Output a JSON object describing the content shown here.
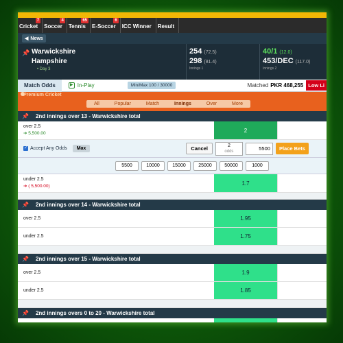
{
  "sports": [
    {
      "label": "Cricket",
      "badge": "7"
    },
    {
      "label": "Soccer",
      "badge": "4"
    },
    {
      "label": "Tennis",
      "badge": "65"
    },
    {
      "label": "E-Soccer",
      "badge": "6"
    },
    {
      "label": "ICC Winner",
      "badge": ""
    },
    {
      "label": "Result",
      "badge": ""
    }
  ],
  "news_label": "News",
  "scoreboard": {
    "team1": "Warwickshire",
    "team2": "Hampshire",
    "day": "Day 3",
    "score1": "254",
    "overs1": "(72.5)",
    "score2": "298",
    "overs2": "(81.4)",
    "innings1": "Innings 1",
    "right_score1": "40/1",
    "right_overs1": "(12.0)",
    "right_score2": "453/DEC",
    "right_overs2": "(117.0)",
    "innings2": "Innings 2"
  },
  "oddsbar": {
    "match_odds": "Match Odds",
    "inplay": "In-Play",
    "minmax": "Min/Max 100 / 30000",
    "matched_label": "Matched",
    "matched_value": "PKR 468,255",
    "low_liquidity": "Low Li"
  },
  "filter": {
    "ghost_text": "Premium Cricket",
    "tabs": [
      "All",
      "Popular",
      "Match",
      "Innings",
      "Over",
      "More"
    ]
  },
  "markets": [
    {
      "title": "2nd innings over 13 - Warwickshire total",
      "over": {
        "label": "over 2.5",
        "pl": "5,500.00",
        "odds": "2"
      },
      "betslip": {
        "accept": "Accept Any Odds",
        "max": "Max",
        "cancel": "Cancel",
        "odds_value": "2",
        "odds_label": "odds",
        "stake": "5500",
        "place": "Place Bets"
      },
      "stakes": [
        "5500",
        "10000",
        "15000",
        "25000",
        "50000",
        "1000"
      ],
      "under": {
        "label": "under 2.5",
        "pl": "( 5,500.00)",
        "odds": "1.7"
      }
    },
    {
      "title": "2nd innings over 14 - Warwickshire total",
      "over": {
        "label": "over 2.5",
        "odds": "1.95"
      },
      "under": {
        "label": "under 2.5",
        "odds": "1.75"
      }
    },
    {
      "title": "2nd innings over 15 - Warwickshire total",
      "over": {
        "label": "over 2.5",
        "odds": "1.9"
      },
      "under": {
        "label": "under 2.5",
        "odds": "1.85"
      }
    },
    {
      "title": "2nd innings overs 0 to 20 - Warwickshire total"
    }
  ],
  "colors": {
    "accent": "#f2b705",
    "header": "#243a48",
    "odds_green": "#2fe08a",
    "filter_orange": "#e8611e"
  }
}
